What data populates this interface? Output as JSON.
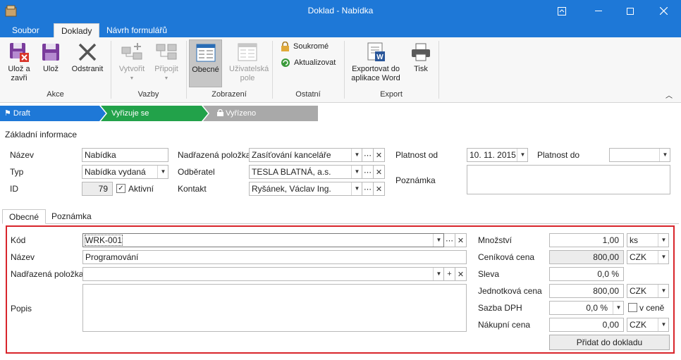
{
  "window": {
    "title": "Doklad - Nabídka"
  },
  "ribbon_tabs": [
    "Soubor",
    "Doklady",
    "Návrh formulářů"
  ],
  "ribbon": {
    "groups": {
      "akce": {
        "label": "Akce",
        "save_close": "Ulož a zavři",
        "save": "Ulož",
        "delete": "Odstranit"
      },
      "vazby": {
        "label": "Vazby",
        "create": "Vytvořit",
        "attach": "Připojit"
      },
      "zobrazeni": {
        "label": "Zobrazení",
        "general": "Obecné",
        "custom_fields": "Uživatelská pole"
      },
      "ostatni": {
        "label": "Ostatní",
        "private": "Soukromé",
        "refresh": "Aktualizovat"
      },
      "export": {
        "label": "Export",
        "word": "Exportovat do aplikace Word",
        "print": "Tisk"
      }
    }
  },
  "workflow": {
    "steps": [
      "Draft",
      "Vyřizuje se",
      "Vyřízeno"
    ],
    "colors": {
      "draft": "#1e78d7",
      "active": "#22a24a",
      "done": "#a9a9a9"
    }
  },
  "header": {
    "section_title": "Základní informace",
    "nazev_label": "Název",
    "nazev_value": "Nabídka",
    "typ_label": "Typ",
    "typ_value": "Nabídka vydaná",
    "id_label": "ID",
    "id_value": "79",
    "aktivni_label": "Aktivní",
    "aktivni_checked": true,
    "nadrazena_label": "Nadřazená položka",
    "nadrazena_value": "Zasíťování kanceláře",
    "odberatel_label": "Odběratel",
    "odberatel_value": "TESLA BLATNÁ, a.s.",
    "kontakt_label": "Kontakt",
    "kontakt_value": "Ryšánek, Václav Ing.",
    "platnost_od_label": "Platnost od",
    "platnost_od_value": "10. 11. 2015",
    "platnost_do_label": "Platnost do",
    "platnost_do_value": "",
    "poznamka_label": "Poznámka",
    "poznamka_value": ""
  },
  "subtabs": [
    "Obecné",
    "Poznámka"
  ],
  "item": {
    "kod_label": "Kód",
    "kod_value": "WRK-001",
    "nazev_label": "Název",
    "nazev_value": "Programování",
    "nadrazena_label": "Nadřazená položka",
    "nadrazena_value": "",
    "popis_label": "Popis",
    "popis_value": "",
    "mnozstvi_label": "Množství",
    "mnozstvi_value": "1,00",
    "mnozstvi_unit": "ks",
    "cenikova_label": "Ceníková cena",
    "cenikova_value": "800,00",
    "cenikova_currency": "CZK",
    "sleva_label": "Sleva",
    "sleva_value": "0,0 %",
    "jednotkova_label": "Jednotková cena",
    "jednotkova_value": "800,00",
    "jednotkova_currency": "CZK",
    "dph_label": "Sazba DPH",
    "dph_value": "0,0 %",
    "v_cene_label": "v ceně",
    "nakupni_label": "Nákupní cena",
    "nakupni_value": "0,00",
    "nakupni_currency": "CZK",
    "add_button": "Přidat do dokladu"
  }
}
